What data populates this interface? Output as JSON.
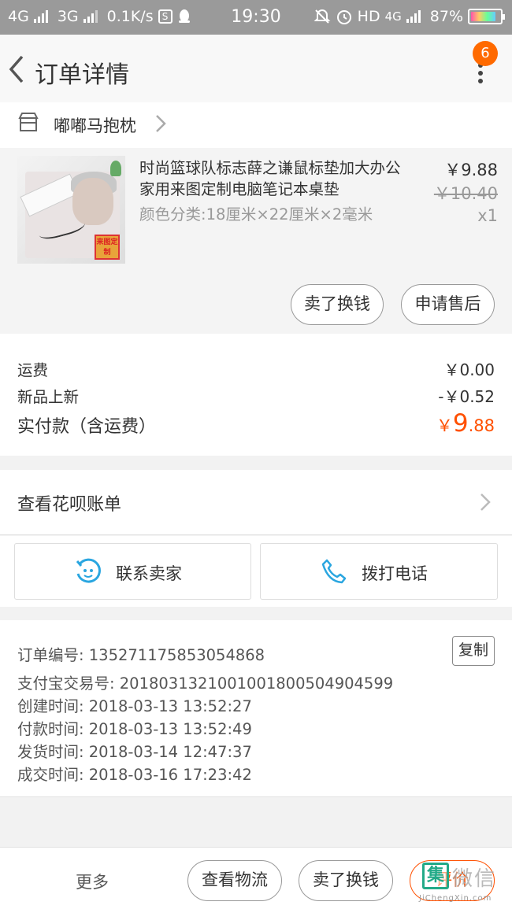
{
  "status_bar": {
    "network1": "4G",
    "network2": "3G",
    "speed": "0.1K/s",
    "time": "19:30",
    "hd": "HD",
    "network3": "4G",
    "battery": "87%"
  },
  "header": {
    "title": "订单详情",
    "badge": "6"
  },
  "shop": {
    "name": "嘟嘟马抱枕"
  },
  "product": {
    "name": "时尚篮球队标志薛之谦鼠标垫加大办公家用来图定制电脑笔记本桌垫",
    "sku": "颜色分类:18厘米×22厘米×2毫米",
    "price": "￥9.88",
    "original_price": "￥10.40",
    "quantity": "x1",
    "stamp_text": "来图定制",
    "sell_label": "卖了换钱",
    "after_sale_label": "申请售后"
  },
  "fees": {
    "shipping_label": "运费",
    "shipping_value": "￥0.00",
    "promo_label": "新品上新",
    "promo_value": "-￥0.52",
    "total_label": "实付款（含运费）",
    "total_currency": "￥",
    "total_int": "9",
    "total_dec": ".88"
  },
  "huabei": {
    "label": "查看花呗账单"
  },
  "contact": {
    "seller_label": "联系卖家",
    "call_label": "拨打电话"
  },
  "order_info": {
    "order_no": "订单编号: 1352711758530548​68",
    "alipay_no": "支付宝交易号: 2018031321001001800504904599",
    "created": "创建时间: 2018-03-13 13:52:27",
    "paid": "付款时间: 2018-03-13 13:52:49",
    "shipped": "发货时间: 2018-03-14 12:47:37",
    "completed": "成交时间: 2018-03-16 17:23:42",
    "copy_label": "复制"
  },
  "bottom_bar": {
    "more_label": "更多",
    "logistics_label": "查看物流",
    "sell_label": "卖了换钱",
    "rate_label": "评价"
  },
  "watermark": {
    "mark": "集",
    "text": "微信",
    "url": "JiChengXin.com"
  },
  "colors": {
    "accent": "#ff5000",
    "badge": "#ff6a00",
    "status_bar": "#9a9a9a",
    "contact_icon": "#2aa6e0"
  }
}
